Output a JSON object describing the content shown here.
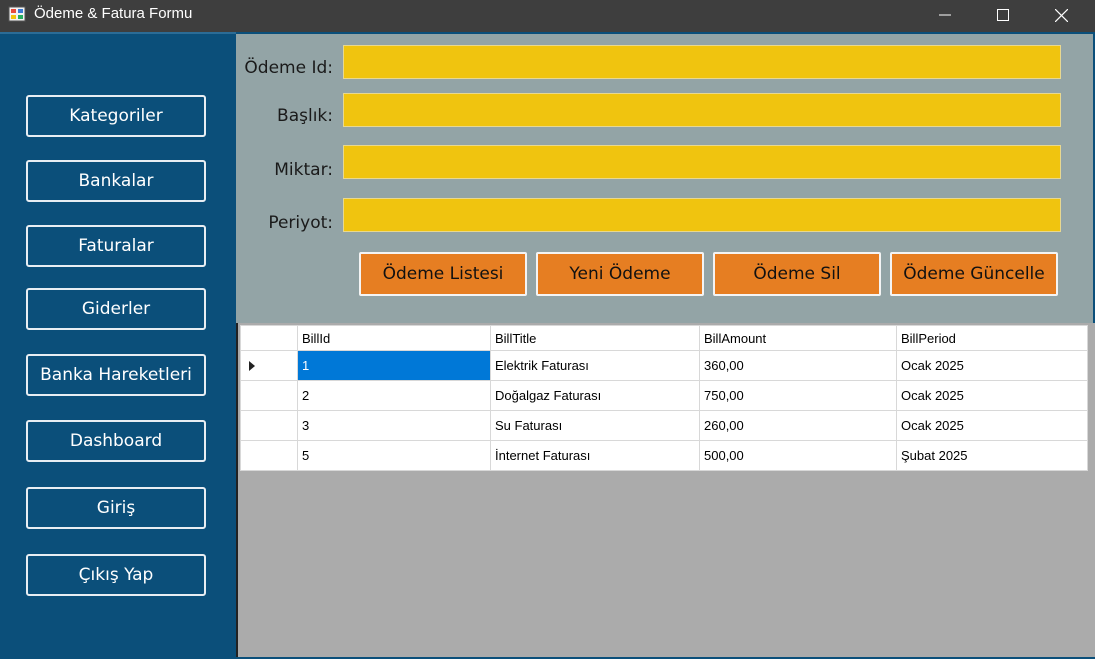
{
  "window": {
    "title": "Ödeme & Fatura Formu",
    "controls": [
      "minimize",
      "maximize",
      "close"
    ]
  },
  "sidebar": {
    "items": [
      {
        "label": "Kategoriler"
      },
      {
        "label": "Bankalar"
      },
      {
        "label": "Faturalar"
      },
      {
        "label": "Giderler"
      },
      {
        "label": "Banka Hareketleri"
      },
      {
        "label": "Dashboard"
      },
      {
        "label": "Giriş"
      },
      {
        "label": "Çıkış Yap"
      }
    ]
  },
  "form": {
    "fields": [
      {
        "label": "Ödeme Id:",
        "value": ""
      },
      {
        "label": "Başlık:",
        "value": ""
      },
      {
        "label": "Miktar:",
        "value": ""
      },
      {
        "label": "Periyot:",
        "value": ""
      }
    ],
    "buttons": [
      {
        "label": "Ödeme Listesi"
      },
      {
        "label": "Yeni Ödeme"
      },
      {
        "label": "Ödeme Sil"
      },
      {
        "label": "Ödeme Güncelle"
      }
    ]
  },
  "grid": {
    "columns": [
      "BillId",
      "BillTitle",
      "BillAmount",
      "BillPeriod"
    ],
    "rows": [
      [
        "1",
        "Elektrik Faturası",
        "360,00",
        "Ocak 2025"
      ],
      [
        "2",
        "Doğalgaz Faturası",
        "750,00",
        "Ocak 2025"
      ],
      [
        "3",
        "Su Faturası",
        "260,00",
        "Ocak 2025"
      ],
      [
        "5",
        "İnternet Faturası",
        "500,00",
        "Şubat 2025"
      ]
    ],
    "selected_row": 0
  },
  "colors": {
    "sidebar_bg": "#0b4f7a",
    "form_bg": "#93a4a6",
    "input_bg": "#f0c40f",
    "button_bg": "#e67e22",
    "selection": "#0078d7"
  }
}
